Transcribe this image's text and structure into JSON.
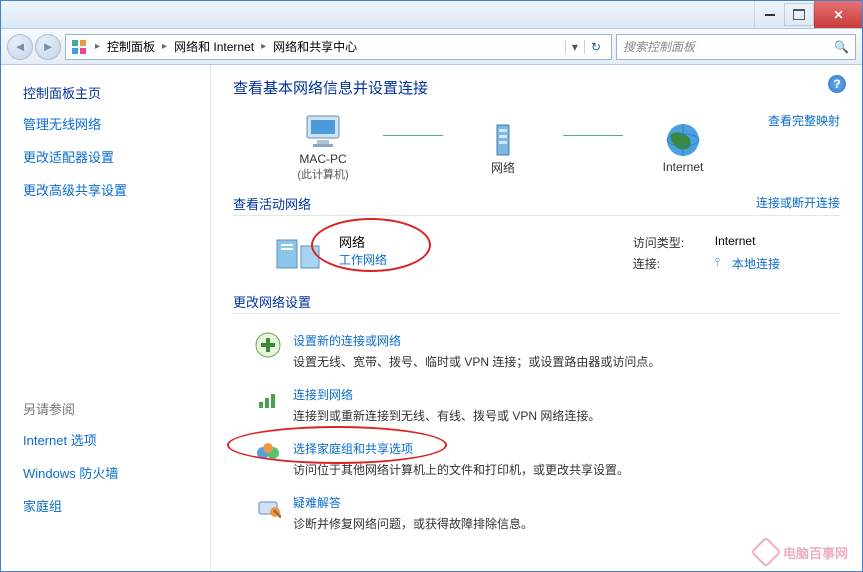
{
  "breadcrumb": {
    "items": [
      "控制面板",
      "网络和 Internet",
      "网络和共享中心"
    ]
  },
  "search": {
    "placeholder": "搜索控制面板"
  },
  "sidebar": {
    "heading": "控制面板主页",
    "links": [
      "管理无线网络",
      "更改适配器设置",
      "更改高级共享设置"
    ],
    "also_heading": "另请参阅",
    "also_links": [
      "Internet 选项",
      "Windows 防火墙",
      "家庭组"
    ]
  },
  "content": {
    "title": "查看基本网络信息并设置连接",
    "full_map_link": "查看完整映射",
    "map": {
      "node1": {
        "label": "MAC-PC",
        "sub": "(此计算机)"
      },
      "node2": {
        "label": "网络"
      },
      "node3": {
        "label": "Internet"
      }
    },
    "active_section": {
      "heading": "查看活动网络",
      "right_action": "连接或断开连接",
      "network": {
        "name": "网络",
        "type": "工作网络",
        "access_label": "访问类型:",
        "access_value": "Internet",
        "connect_label": "连接:",
        "connect_value": "本地连接"
      }
    },
    "change_section": {
      "heading": "更改网络设置",
      "items": [
        {
          "title": "设置新的连接或网络",
          "desc": "设置无线、宽带、拨号、临时或 VPN 连接；或设置路由器或访问点。"
        },
        {
          "title": "连接到网络",
          "desc": "连接到或重新连接到无线、有线、拨号或 VPN 网络连接。"
        },
        {
          "title": "选择家庭组和共享选项",
          "desc": "访问位于其他网络计算机上的文件和打印机，或更改共享设置。"
        },
        {
          "title": "疑难解答",
          "desc": "诊断并修复网络问题，或获得故障排除信息。"
        }
      ]
    }
  },
  "watermark": "电脑百事网"
}
